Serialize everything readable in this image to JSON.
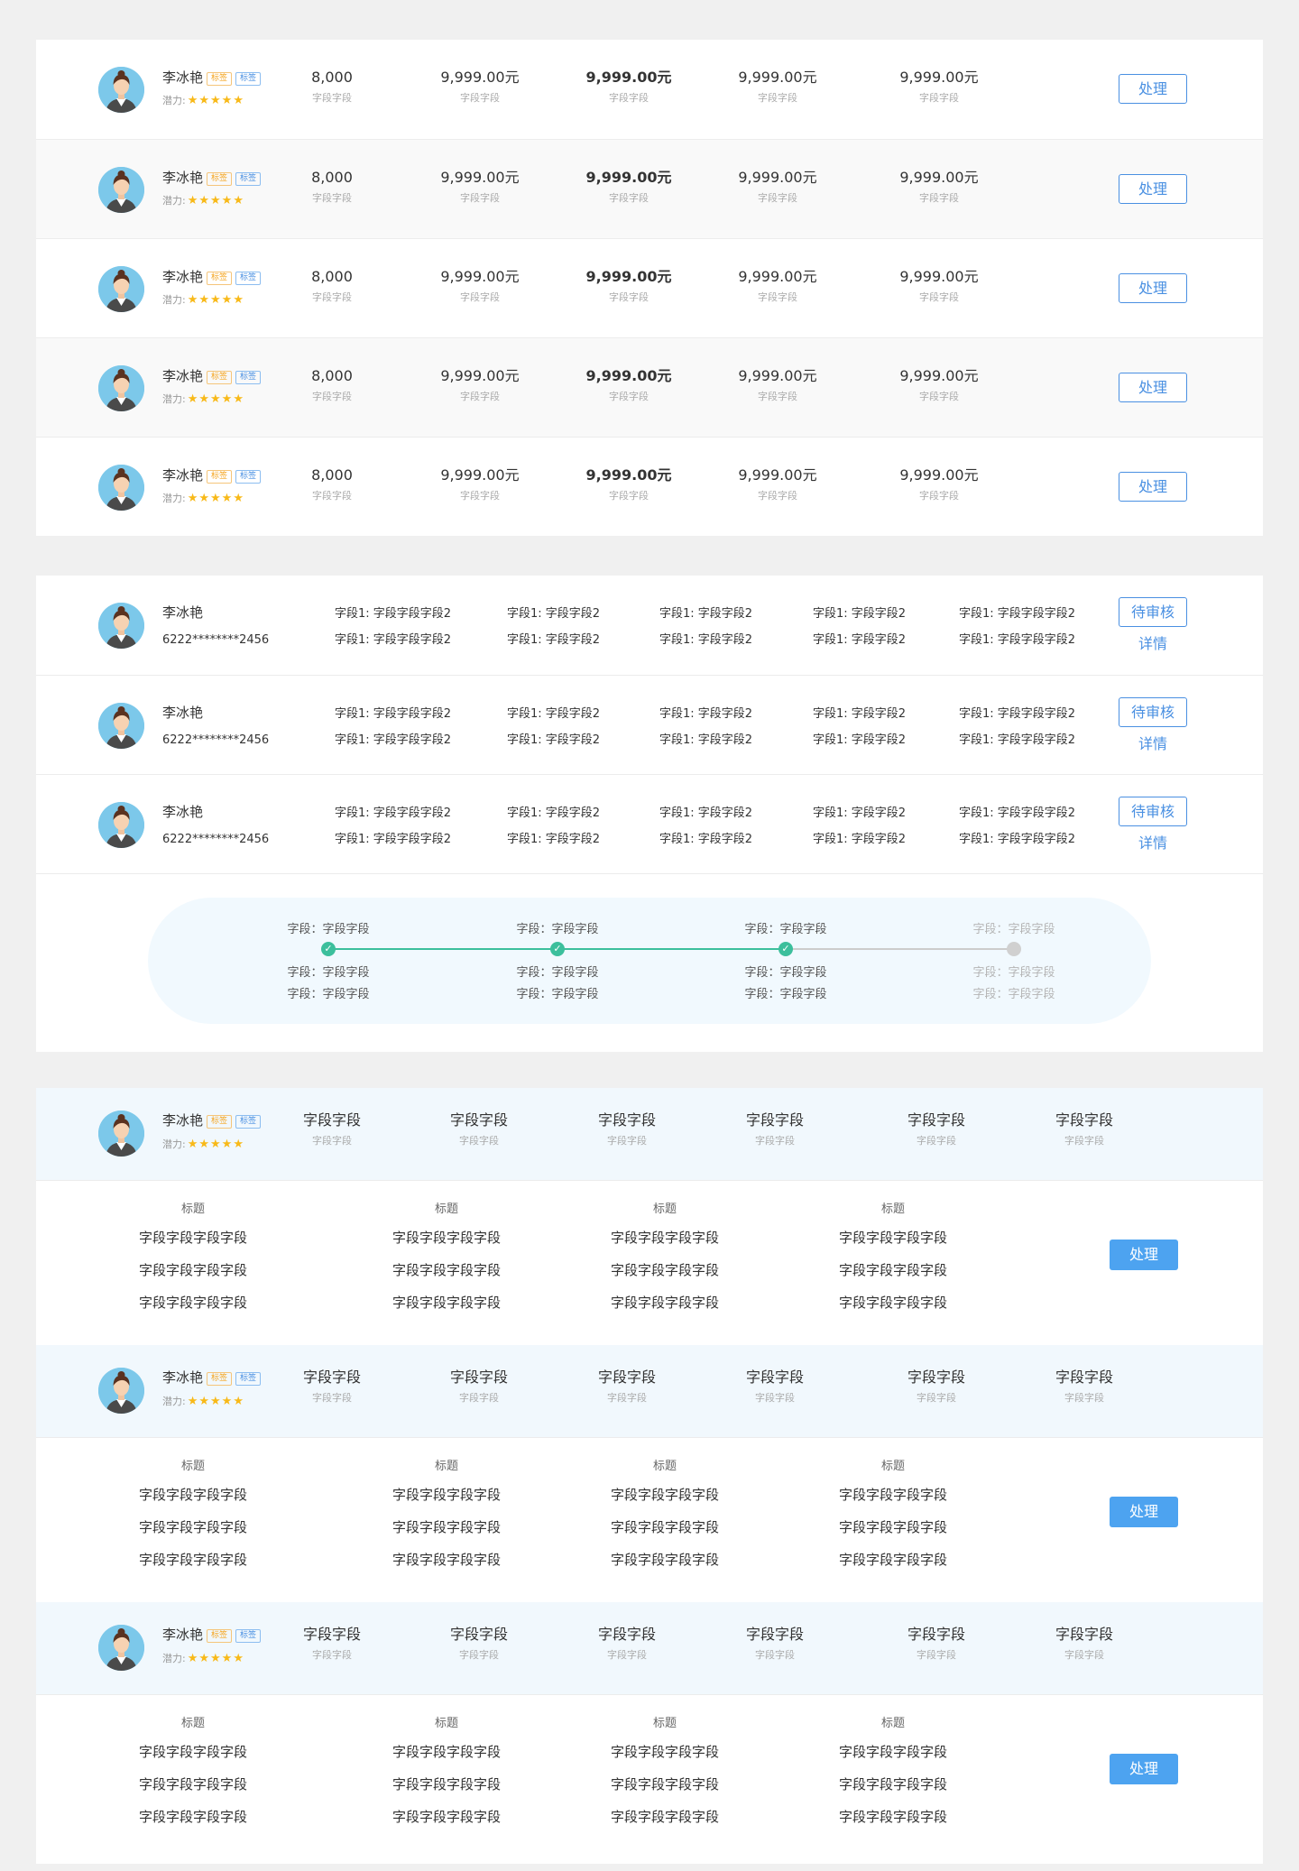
{
  "person": {
    "name": "李冰艳",
    "tag1": "标签",
    "tag2": "标签",
    "potential_label": "潜力:",
    "stars": "★★★★★",
    "card": "6222********2456"
  },
  "list1": {
    "count_value": "8,000",
    "money_value": "9,999.00元",
    "sub_label": "字段字段",
    "action": "处理"
  },
  "list2": {
    "field_a": "字段1:  字段字段字段2",
    "field_b": "字段1:  字段字段2",
    "status": "待审核",
    "detail": "详情"
  },
  "progress": {
    "item": "字段：字段字段",
    "check": "✓"
  },
  "list3": {
    "head_value": "字段字段",
    "head_sub": "字段字段",
    "col_title": "标题",
    "col_value": "字段字段字段字段",
    "action": "处理"
  },
  "colors": {
    "accent": "#4a90e2",
    "button_fill": "#4da3f0",
    "progress_done": "#3cbf9c",
    "star": "#f8b918",
    "tag_orange": "#f5a623"
  }
}
